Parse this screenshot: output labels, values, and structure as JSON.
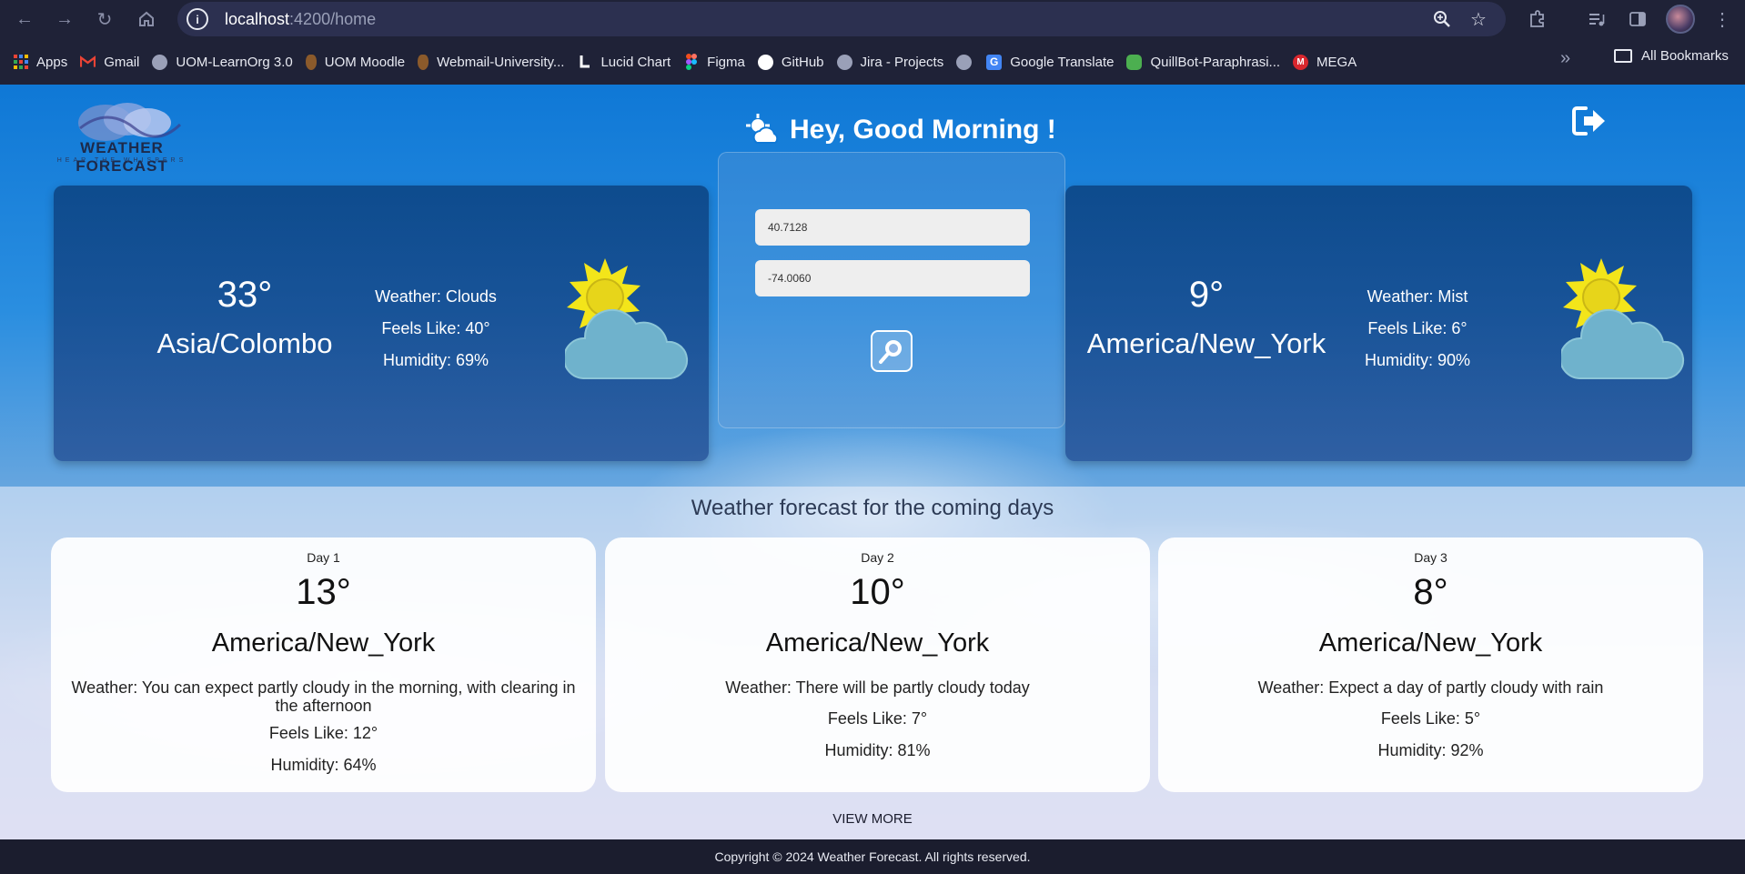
{
  "browser": {
    "url_host": "localhost",
    "url_path": ":4200/home",
    "bookmarks": [
      {
        "label": "Apps",
        "icon": "apps-grid-icon",
        "color": "#ea4335"
      },
      {
        "label": "Gmail",
        "icon": "gmail-icon",
        "color": "#ea4335"
      },
      {
        "label": "UOM-LearnOrg 3.0",
        "icon": "globe-icon",
        "color": "#9aa0b8"
      },
      {
        "label": "UOM Moodle",
        "icon": "crest-icon",
        "color": "#8b5a2b"
      },
      {
        "label": "Webmail-University...",
        "icon": "crest-icon",
        "color": "#8b5a2b"
      },
      {
        "label": "Lucid Chart",
        "icon": "lucid-icon",
        "color": "#ffffff"
      },
      {
        "label": "Figma",
        "icon": "figma-icon",
        "color": "#f24e1e"
      },
      {
        "label": "GitHub",
        "icon": "github-icon",
        "color": "#ffffff"
      },
      {
        "label": "Jira - Projects",
        "icon": "globe-icon",
        "color": "#9aa0b8"
      },
      {
        "label": "",
        "icon": "globe-icon",
        "color": "#9aa0b8"
      },
      {
        "label": "Google Translate",
        "icon": "translate-icon",
        "color": "#4285f4"
      },
      {
        "label": "QuillBot-Paraphrasi...",
        "icon": "quillbot-icon",
        "color": "#4caf50"
      },
      {
        "label": "MEGA",
        "icon": "mega-icon",
        "color": "#d9272e"
      }
    ],
    "all_bookmarks": "All Bookmarks"
  },
  "header": {
    "logo_title": "WEATHER FORECAST",
    "logo_subtitle": "HEAR THE WHISPERS",
    "greeting": "Hey, Good Morning !"
  },
  "current": {
    "temp": "33°",
    "city": "Asia/Colombo",
    "weather": "Weather: Clouds",
    "feels_like": "Feels Like: 40°",
    "humidity": "Humidity: 69%"
  },
  "search": {
    "latitude": "40.7128",
    "longitude": "-74.0060"
  },
  "searched": {
    "temp": "9°",
    "city": "America/New_York",
    "weather": "Weather: Mist",
    "feels_like": "Feels Like: 6°",
    "humidity": "Humidity: 90%"
  },
  "forecast": {
    "title": "Weather forecast for the coming days",
    "days": [
      {
        "label": "Day 1",
        "temp": "13°",
        "city": "America/New_York",
        "weather": "Weather: You can expect partly cloudy in the morning, with clearing in the afternoon",
        "feels_like": "Feels Like: 12°",
        "humidity": "Humidity: 64%"
      },
      {
        "label": "Day 2",
        "temp": "10°",
        "city": "America/New_York",
        "weather": "Weather: There will be partly cloudy today",
        "feels_like": "Feels Like: 7°",
        "humidity": "Humidity: 81%"
      },
      {
        "label": "Day 3",
        "temp": "8°",
        "city": "America/New_York",
        "weather": "Weather: Expect a day of partly cloudy with rain",
        "feels_like": "Feels Like: 5°",
        "humidity": "Humidity: 92%"
      }
    ],
    "view_more": "VIEW MORE"
  },
  "footer": {
    "copyright": "Copyright © 2024 Weather Forecast. All rights reserved."
  }
}
